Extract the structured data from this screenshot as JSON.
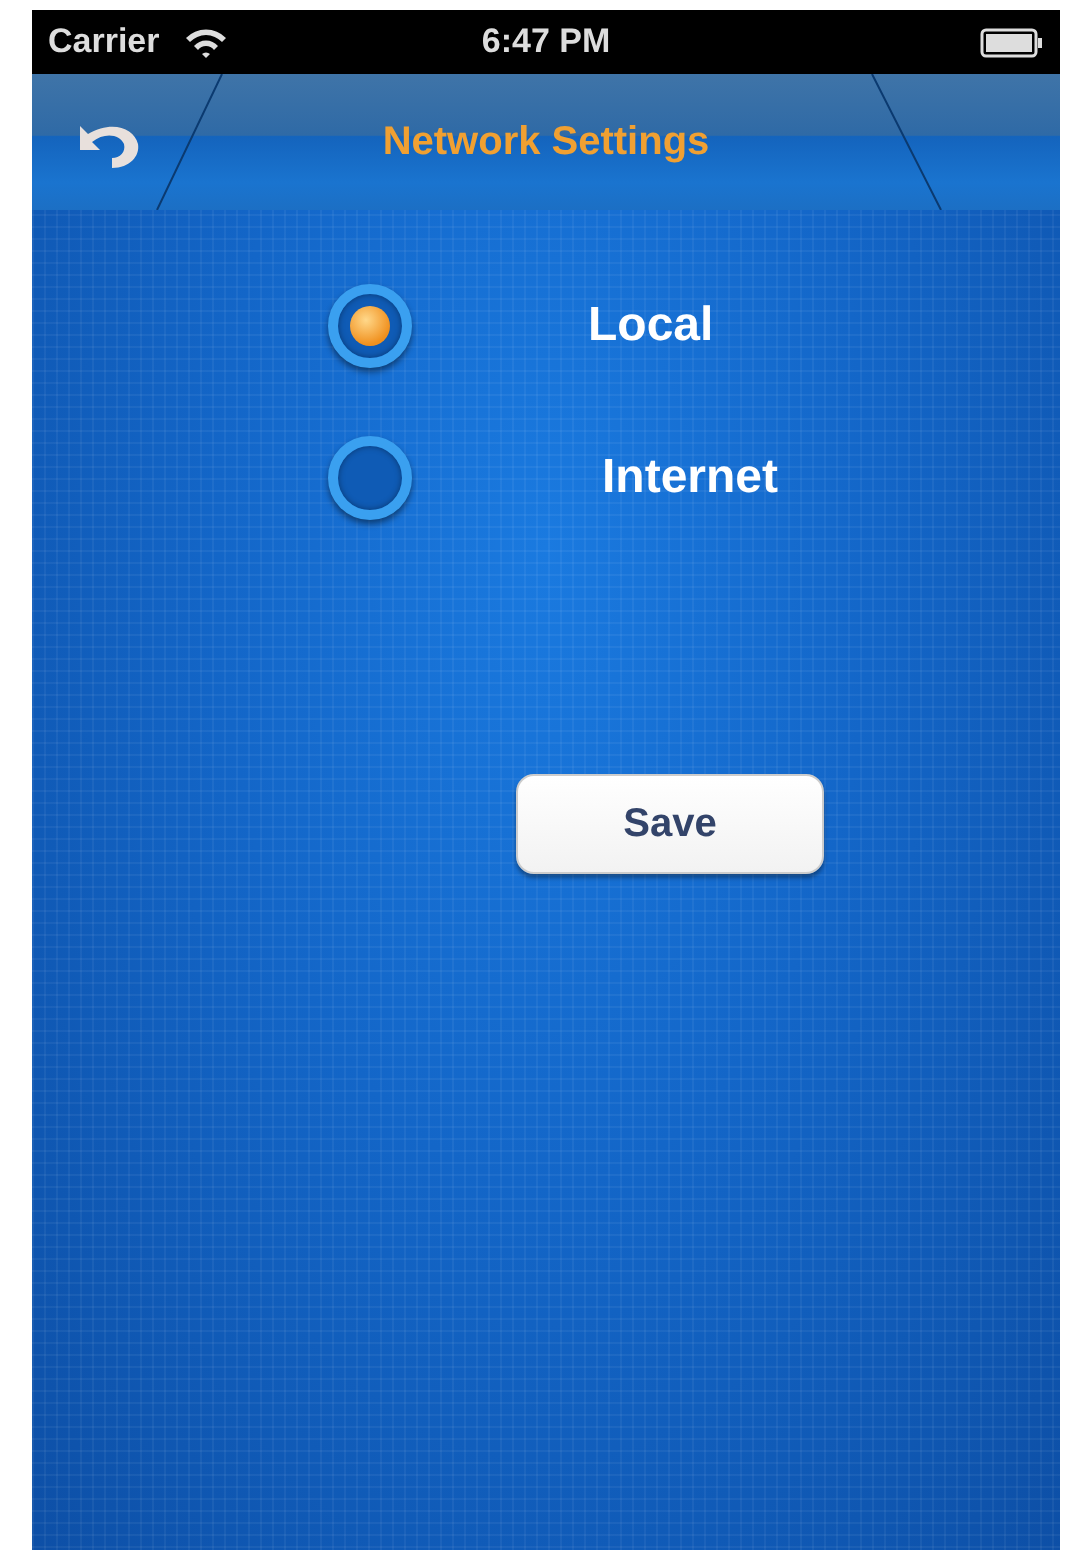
{
  "status_bar": {
    "carrier": "Carrier",
    "time": "6:47 PM"
  },
  "nav_bar": {
    "title": "Network Settings"
  },
  "options": [
    {
      "label": "Local",
      "selected": true
    },
    {
      "label": "Internet",
      "selected": false
    }
  ],
  "buttons": [
    {
      "label": "Save"
    }
  ]
}
